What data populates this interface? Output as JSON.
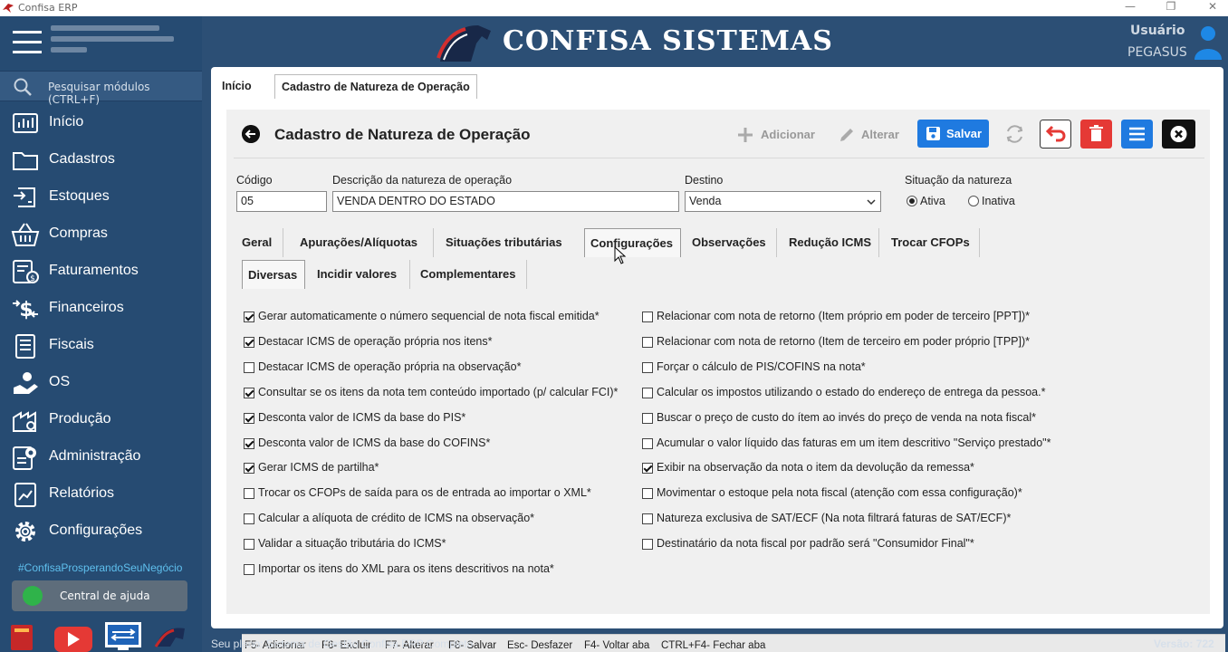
{
  "window": {
    "title": "Confisa ERP",
    "min": "—",
    "restore": "❐",
    "close": "✕"
  },
  "header": {
    "brand": "CONFISA SISTEMAS",
    "user_label": "Usuário",
    "user_name": "PEGASUS"
  },
  "sidebar": {
    "search_placeholder": "Pesquisar módulos (CTRL+F)",
    "items": [
      {
        "label": "Início",
        "icon": "chart-icon"
      },
      {
        "label": "Cadastros",
        "icon": "folder-icon"
      },
      {
        "label": "Estoques",
        "icon": "stock-icon"
      },
      {
        "label": "Compras",
        "icon": "basket-icon"
      },
      {
        "label": "Faturamentos",
        "icon": "invoice-icon"
      },
      {
        "label": "Financeiros",
        "icon": "money-icon"
      },
      {
        "label": "Fiscais",
        "icon": "document-icon"
      },
      {
        "label": "OS",
        "icon": "service-icon"
      },
      {
        "label": "Produção",
        "icon": "factory-icon"
      },
      {
        "label": "Administração",
        "icon": "admin-icon"
      },
      {
        "label": "Relatórios",
        "icon": "report-icon"
      },
      {
        "label": "Configurações",
        "icon": "gear-icon"
      }
    ],
    "tagline": "#ConfisaProsperandoSeuNegócio",
    "help_label": "Central de ajuda"
  },
  "page_tabs": [
    "Início",
    "Cadastro de Natureza de Operação"
  ],
  "form": {
    "title": "Cadastro de Natureza de Operação",
    "toolbar": {
      "add": "Adicionar",
      "edit": "Alterar",
      "save": "Salvar"
    },
    "fields": {
      "code_label": "Código",
      "code_value": "05",
      "desc_label": "Descrição da natureza de operação",
      "desc_value": "VENDA DENTRO DO ESTADO",
      "dest_label": "Destino",
      "dest_value": "Venda",
      "status_label": "Situação da natureza",
      "status_active": "Ativa",
      "status_inactive": "Inativa"
    },
    "tabs": [
      "Geral",
      "Apurações/Alíquotas",
      "Situações tributárias",
      "Configurações",
      "Observações",
      "Redução ICMS",
      "Trocar CFOPs"
    ],
    "subtabs": [
      "Diversas",
      "Incidir valores",
      "Complementares"
    ],
    "left_options": [
      {
        "label": "Gerar automaticamente o número sequencial de nota fiscal emitida*",
        "checked": true
      },
      {
        "label": "Destacar ICMS de operação própria nos itens*",
        "checked": true
      },
      {
        "label": "Destacar ICMS de operação própria na observação*",
        "checked": false
      },
      {
        "label": "Consultar se os itens da nota tem conteúdo importado (p/ calcular FCI)*",
        "checked": true
      },
      {
        "label": "Desconta valor de ICMS da base do PIS*",
        "checked": true
      },
      {
        "label": "Desconta valor de ICMS da base do COFINS*",
        "checked": true
      },
      {
        "label": "Gerar ICMS de partilha*",
        "checked": true
      },
      {
        "label": "Trocar os CFOPs de saída para os de entrada ao importar o XML*",
        "checked": false
      },
      {
        "label": "Calcular a alíquota de crédito de ICMS na observação*",
        "checked": false
      },
      {
        "label": "Validar a situação tributária do ICMS*",
        "checked": false
      },
      {
        "label": "Importar os itens do XML para os itens descritivos na nota*",
        "checked": false
      }
    ],
    "right_options": [
      {
        "label": "Relacionar com nota de retorno (Item próprio em poder de terceiro [PPT])*",
        "checked": false
      },
      {
        "label": "Relacionar com nota de retorno (Item de terceiro em poder próprio [TPP])*",
        "checked": false
      },
      {
        "label": "Forçar o cálculo de PIS/COFINS na nota*",
        "checked": false
      },
      {
        "label": "Calcular os impostos utilizando o estado do endereço de entrega da pessoa.*",
        "checked": false
      },
      {
        "label": "Buscar o preço de custo do ítem ao invés do preço de venda na nota fiscal*",
        "checked": false
      },
      {
        "label": "Acumular o valor líquido das faturas em um item descritivo \"Serviço prestado\"*",
        "checked": false
      },
      {
        "label": "Exibir na observação da nota o item da devolução da remessa*",
        "checked": true
      },
      {
        "label": "Movimentar o estoque pela nota fiscal (atenção com essa configuração)*",
        "checked": false
      },
      {
        "label": "Natureza exclusiva de SAT/ECF (Na nota filtrará faturas de SAT/ECF)*",
        "checked": false
      },
      {
        "label": "Destinatário da nota fiscal por padrão será \"Consumidor Final\"*",
        "checked": false
      }
    ],
    "shortcuts": [
      "F5- Adicionar",
      "F6- Excluir",
      "F7- Alterar",
      "F8- Salvar",
      "Esc- Desfazer",
      "F4- Voltar aba",
      "CTRL+F4- Fechar aba"
    ]
  },
  "footer": {
    "plan": "Seu plano: Sistema de Gestão Confisa ERP Completo",
    "version": "Versão: 722"
  },
  "colors": {
    "sidebar": "#264b72",
    "header": "#2c4f75",
    "save": "#1f7ae0",
    "delete": "#e53935",
    "menu": "#1f7ae0",
    "close": "#111111",
    "tagline": "#5fc0ee"
  }
}
